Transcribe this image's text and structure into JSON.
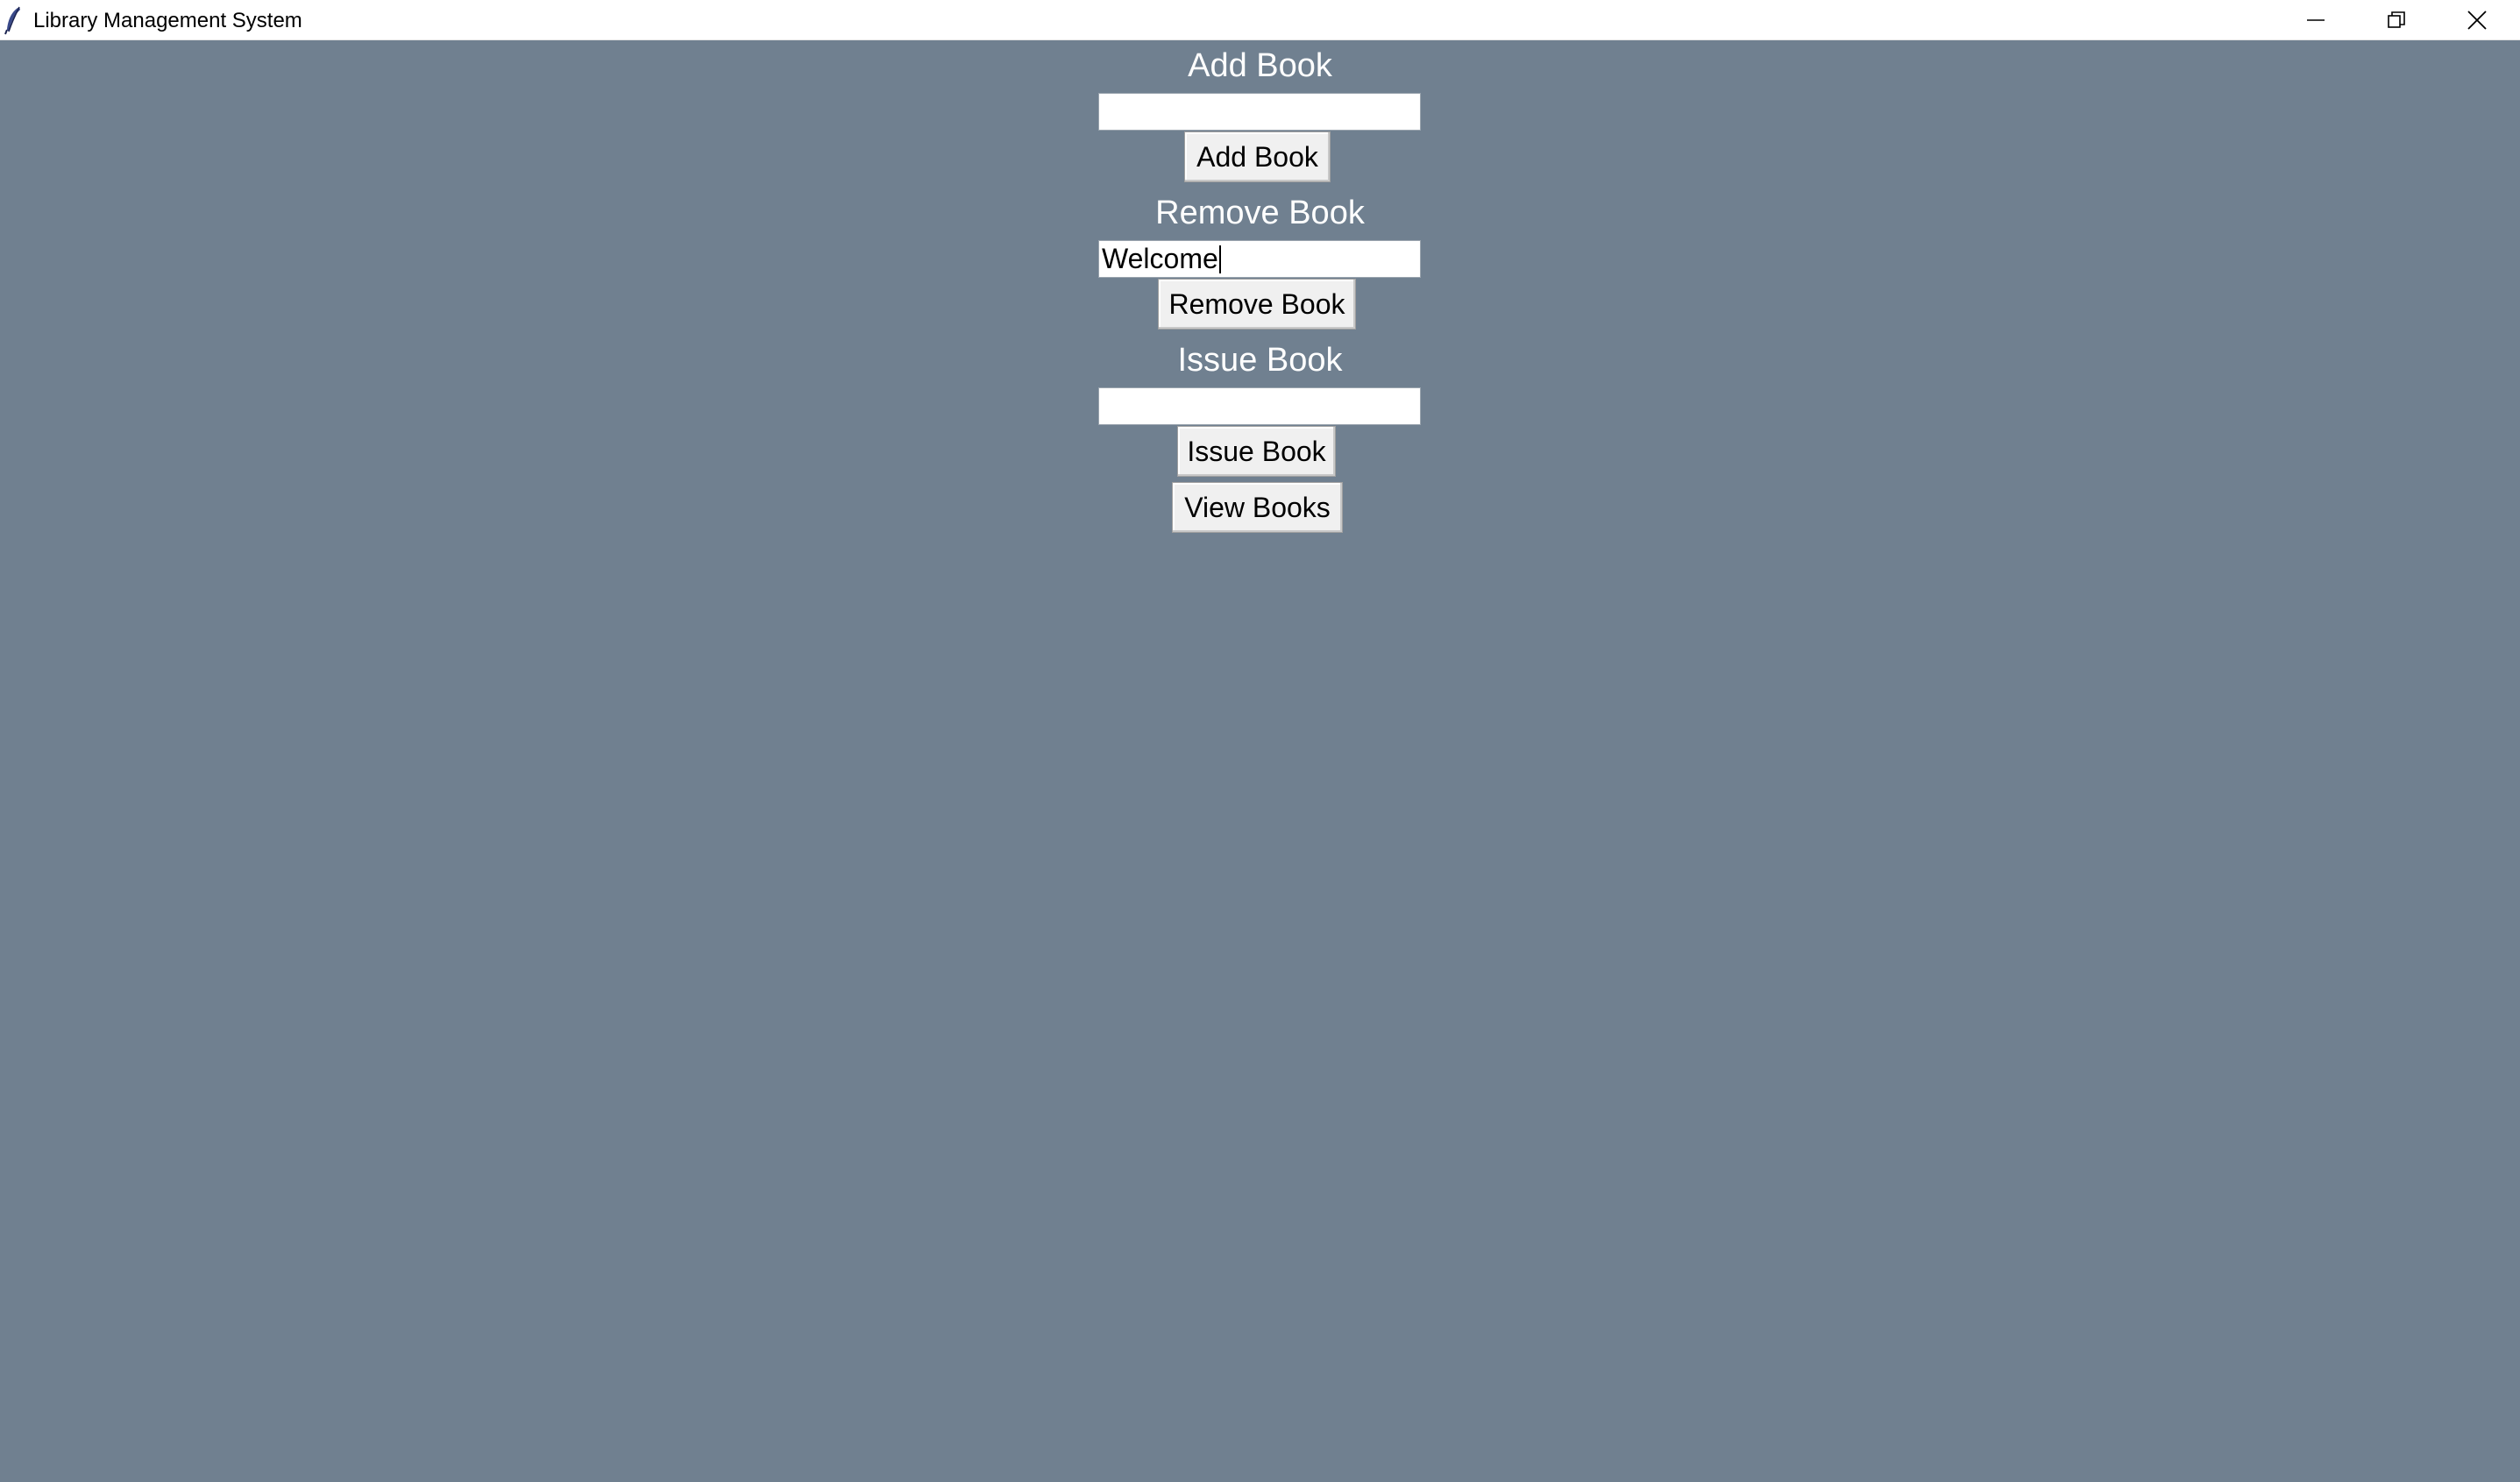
{
  "window": {
    "title": "Library Management System",
    "icon": "feather-icon",
    "controls": {
      "minimize": "minimize-icon",
      "maximize": "restore-icon",
      "close": "close-icon"
    }
  },
  "colors": {
    "background": "#708090",
    "heading_text": "#ffffff",
    "button_face": "#f0f0f0",
    "entry_bg": "#ffffff"
  },
  "add_section": {
    "heading": "Add Book",
    "entry_value": "",
    "button_label": "Add Book"
  },
  "remove_section": {
    "heading": "Remove Book",
    "entry_value": "Welcome",
    "button_label": "Remove Book"
  },
  "issue_section": {
    "heading": "Issue Book",
    "entry_value": "",
    "button_label": "Issue Book"
  },
  "view_button_label": "View Books"
}
